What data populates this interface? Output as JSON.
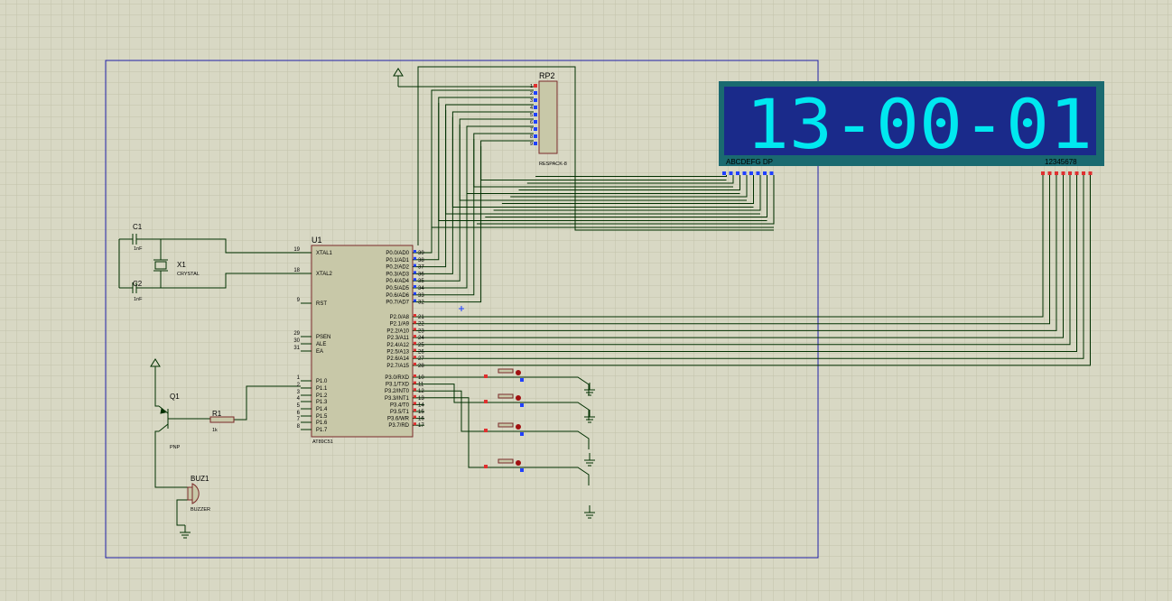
{
  "colors": {
    "background": "#d8d8c4",
    "grid": "#c4c4ae",
    "frame": "#2020a8",
    "wire": "#003000",
    "chip": "#c8c8a8",
    "chip_border": "#7a2a2a",
    "display_bezel": "#1a6a70",
    "display_face": "#1a2a8a",
    "segment_on": "#00e8f0",
    "pin_red": "#e03030",
    "pin_blue": "#2040ff"
  },
  "mcu": {
    "ref": "U1",
    "part": "AT89C51",
    "left_pins": [
      {
        "num": "19",
        "name": "XTAL1"
      },
      {
        "num": "18",
        "name": "XTAL2"
      },
      {
        "num": "9",
        "name": "RST"
      },
      {
        "num": "29",
        "name": "PSEN"
      },
      {
        "num": "30",
        "name": "ALE"
      },
      {
        "num": "31",
        "name": "EA"
      },
      {
        "num": "1",
        "name": "P1.0"
      },
      {
        "num": "2",
        "name": "P1.1"
      },
      {
        "num": "3",
        "name": "P1.2"
      },
      {
        "num": "4",
        "name": "P1.3"
      },
      {
        "num": "5",
        "name": "P1.4"
      },
      {
        "num": "6",
        "name": "P1.5"
      },
      {
        "num": "7",
        "name": "P1.6"
      },
      {
        "num": "8",
        "name": "P1.7"
      }
    ],
    "right_pins": [
      {
        "num": "39",
        "name": "P0.0/AD0"
      },
      {
        "num": "38",
        "name": "P0.1/AD1"
      },
      {
        "num": "37",
        "name": "P0.2/AD2"
      },
      {
        "num": "36",
        "name": "P0.3/AD3"
      },
      {
        "num": "35",
        "name": "P0.4/AD4"
      },
      {
        "num": "34",
        "name": "P0.5/AD5"
      },
      {
        "num": "33",
        "name": "P0.6/AD6"
      },
      {
        "num": "32",
        "name": "P0.7/AD7"
      },
      {
        "num": "21",
        "name": "P2.0/A8"
      },
      {
        "num": "22",
        "name": "P2.1/A9"
      },
      {
        "num": "23",
        "name": "P2.2/A10"
      },
      {
        "num": "24",
        "name": "P2.3/A11"
      },
      {
        "num": "25",
        "name": "P2.4/A12"
      },
      {
        "num": "26",
        "name": "P2.5/A13"
      },
      {
        "num": "27",
        "name": "P2.6/A14"
      },
      {
        "num": "28",
        "name": "P2.7/A15"
      },
      {
        "num": "10",
        "name": "P3.0/RXD"
      },
      {
        "num": "11",
        "name": "P3.1/TXD"
      },
      {
        "num": "12",
        "name": "P3.2/INT0"
      },
      {
        "num": "13",
        "name": "P3.3/INT1"
      },
      {
        "num": "14",
        "name": "P3.4/T0"
      },
      {
        "num": "15",
        "name": "P3.5/T1"
      },
      {
        "num": "16",
        "name": "P3.6/WR"
      },
      {
        "num": "17",
        "name": "P3.7/RD"
      }
    ]
  },
  "display": {
    "digits": "13-00-01",
    "segment_label": "ABCDEFG DP",
    "digit_label": "12345678"
  },
  "respack": {
    "ref": "RP2",
    "part": "RESPACK-8",
    "pins": [
      "1",
      "2",
      "3",
      "4",
      "5",
      "6",
      "7",
      "8",
      "9"
    ]
  },
  "crystal": {
    "ref": "X1",
    "part": "CRYSTAL"
  },
  "c1": {
    "ref": "C1",
    "value": "1nF"
  },
  "c2": {
    "ref": "C2",
    "value": "1nF"
  },
  "q1": {
    "ref": "Q1",
    "part": "PNP"
  },
  "r1": {
    "ref": "R1",
    "value": "1k"
  },
  "buzzer": {
    "ref": "BUZ1",
    "part": "BUZZER"
  }
}
